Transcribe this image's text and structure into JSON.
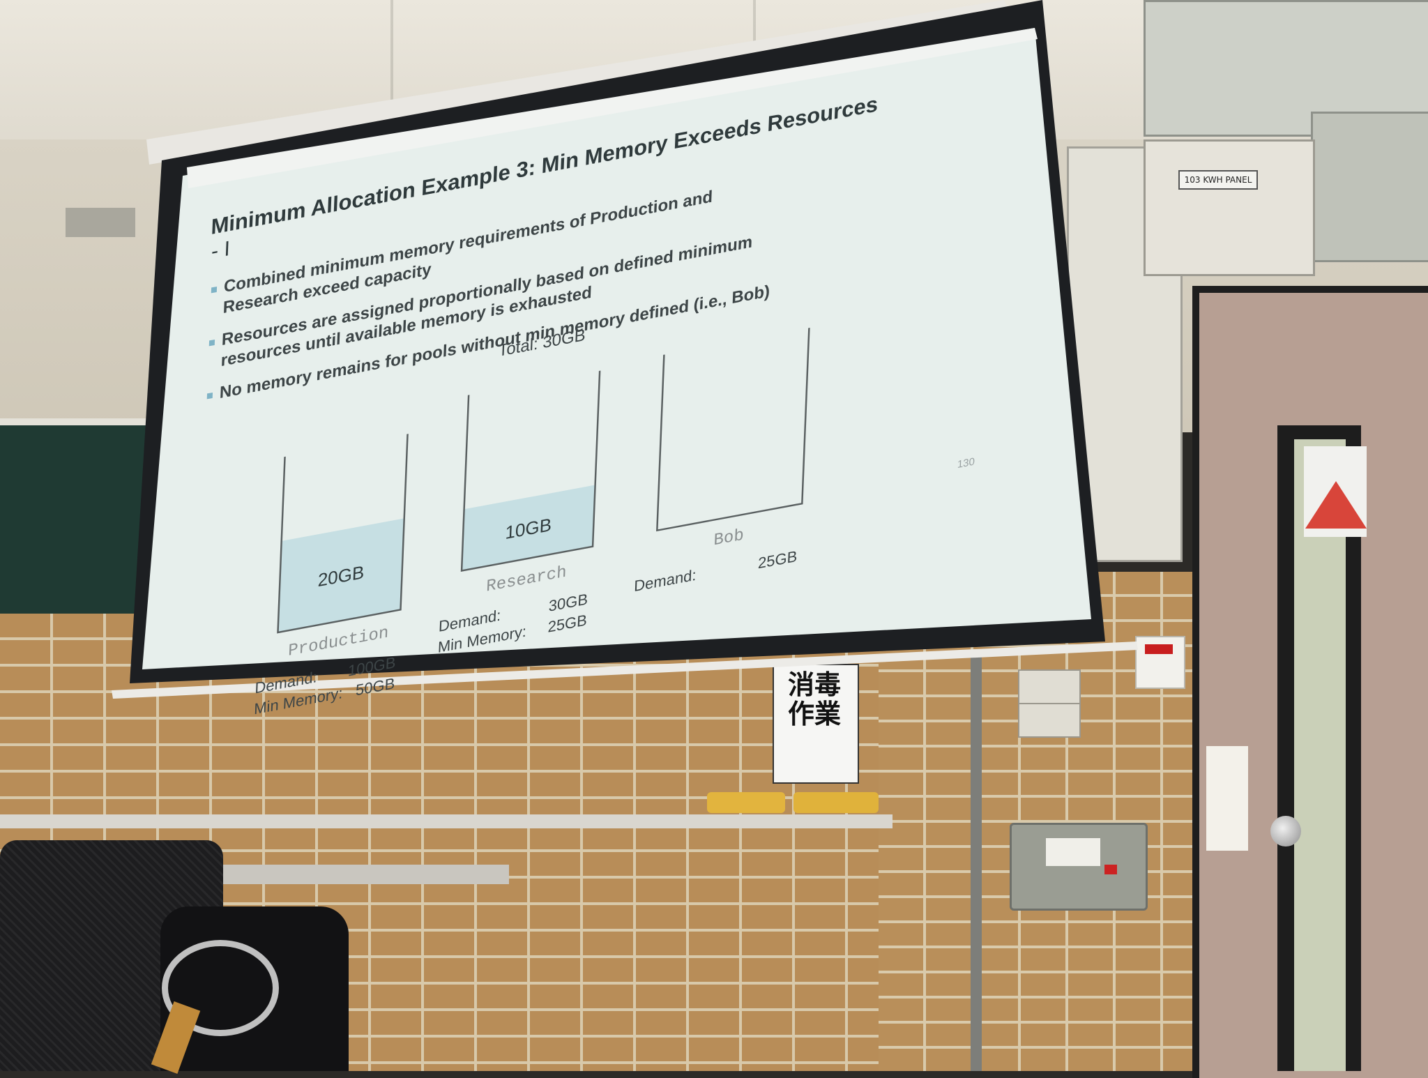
{
  "slide": {
    "title_line1": "Minimum Allocation Example 3: Min Memory Exceeds Resources",
    "title_line2": "- I",
    "bullets": [
      "Combined minimum memory requirements of Production and",
      "Research exceed capacity",
      "Resources are assigned proportionally based on defined minimum",
      "resources until available memory is exhausted",
      "No memory remains for pools without min memory defined (i.e., Bob)"
    ],
    "total_label": "Total: 30GB",
    "pools": [
      {
        "name": "Production",
        "fill_label": "20GB",
        "fill_fraction": 0.52,
        "demand_label": "Demand:",
        "demand_value": "100GB",
        "min_label": "Min Memory:",
        "min_value": "50GB"
      },
      {
        "name": "Research",
        "fill_label": "10GB",
        "fill_fraction": 0.35,
        "demand_label": "Demand:",
        "demand_value": "30GB",
        "min_label": "Min Memory:",
        "min_value": "25GB"
      },
      {
        "name": "Bob",
        "fill_label": "",
        "fill_fraction": 0,
        "demand_label": "Demand:",
        "demand_value": "25GB",
        "min_label": "",
        "min_value": ""
      }
    ],
    "page_number": "130"
  },
  "room": {
    "panel_label": "103 KWH PANEL",
    "poster_text": "消毒作業"
  },
  "colors": {
    "slide_bg": "#e7efec",
    "title": "#2f3a3c",
    "bullet_text": "#3d4547",
    "bullet_marker": "#7fb3c6",
    "fill": "#c6dfe3",
    "label_gray": "#8a8f90",
    "screen_frame": "#1d1f22"
  }
}
